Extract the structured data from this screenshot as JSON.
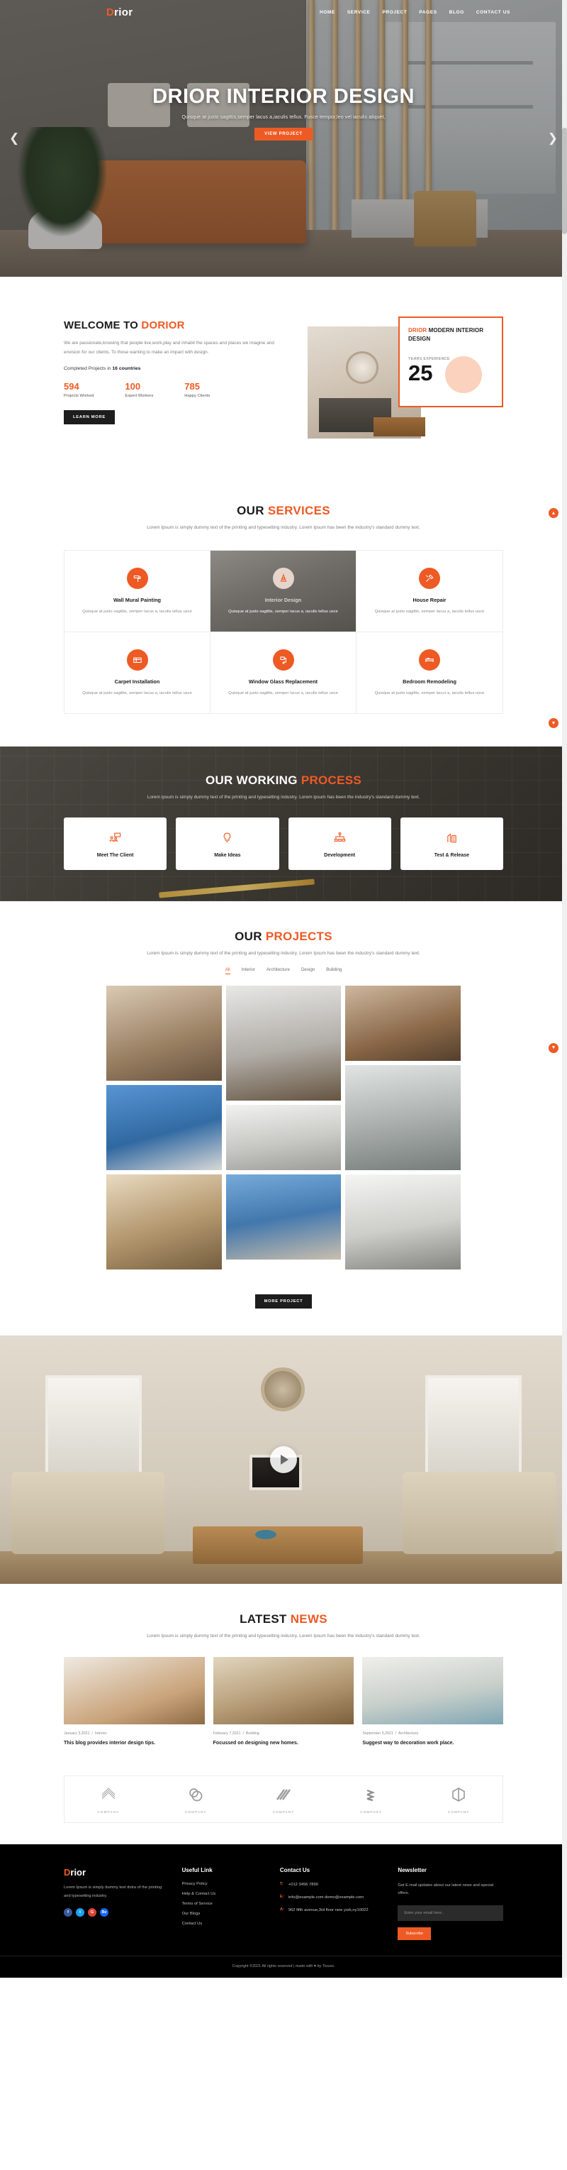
{
  "header": {
    "logo": "Drior",
    "logo_initial": "D",
    "logo_rest": "rior",
    "nav": [
      {
        "label": "HOME"
      },
      {
        "label": "SERVICE"
      },
      {
        "label": "PROJECT"
      },
      {
        "label": "PAGES"
      },
      {
        "label": "BLOG"
      },
      {
        "label": "CONTACT US"
      }
    ]
  },
  "hero": {
    "title": "DRIOR INTERIOR DESIGN",
    "subtitle": "Quisque at justo sagittis,semper lacus a,iaculis tellus. Fusce tempor,leo vel iaculis aliquet,",
    "cta": "VIEW PROJECT",
    "prev_icon": "chevron-left-icon",
    "next_icon": "chevron-right-icon"
  },
  "welcome": {
    "title_main": "WELCOME TO ",
    "title_accent": "DORIOR",
    "body": "We are passionate,knowing that people live,work,play and inhabit the spaces and places we imagine and envision for our clients. To those wanting to make an impact with design.",
    "completed_prefix": "Completed Projects in ",
    "completed_highlight": "16 countries",
    "stats": [
      {
        "number": "594",
        "label": "Projects Worked"
      },
      {
        "number": "100",
        "label": "Expert Workers"
      },
      {
        "number": "785",
        "label": "Happy Clients"
      }
    ],
    "cta": "LEARN MORE",
    "card": {
      "accent": "DRIOR",
      "rest": " MODERN INTERIOR DESIGN",
      "years_label": "YEARS EXPERIENCE",
      "years_value": "25"
    }
  },
  "services": {
    "title_main": "OUR ",
    "title_accent": "SERVICES",
    "subtitle": "Lorem Ipsum is simply dummy text of the printing and typesetting industry. Lorem Ipsum has been the industry's standard dummy text.",
    "items": [
      {
        "name": "Wall Mural Painting",
        "desc": "Quisque at justo sagittis, semper lacus a, iaculis tellus usce",
        "icon": "paint-roller-icon",
        "feature": false
      },
      {
        "name": "Interior Design",
        "desc": "Quisque at justo sagittis, semper lacus a, iaculis tellus usce",
        "icon": "compass-icon",
        "feature": true
      },
      {
        "name": "House Repair",
        "desc": "Quisque at justo sagittis, semper lacus a, iaculis tellus usce",
        "icon": "tools-icon",
        "feature": false
      },
      {
        "name": "Carpet Installation",
        "desc": "Quisque at justo sagittis, semper lacus a, iaculis tellus usce",
        "icon": "carpet-icon",
        "feature": false
      },
      {
        "name": "Window Glass Replacement",
        "desc": "Quisque at justo sagittis, semper lacus a, iaculis tellus usce",
        "icon": "window-spray-icon",
        "feature": false
      },
      {
        "name": "Bedroom Remodeling",
        "desc": "Quisque at justo sagittis, semper lacus a, iaculis tellus usce",
        "icon": "bed-icon",
        "feature": false
      }
    ]
  },
  "process": {
    "title_main": "OUR WORKING ",
    "title_accent": "PROCESS",
    "subtitle": "Lorem ipsum is simply dummy text of the printing and typesetting industry. Lorem ipsum has been the industry's standard dummy text.",
    "steps": [
      {
        "name": "Meet The Client",
        "icon": "meeting-icon"
      },
      {
        "name": "Make Ideas",
        "icon": "lightbulb-icon"
      },
      {
        "name": "Development",
        "icon": "sitemap-icon"
      },
      {
        "name": "Test & Release",
        "icon": "building-icon"
      }
    ]
  },
  "projects": {
    "title_main": "OUR ",
    "title_accent": "PROJECTS",
    "subtitle": "Lorem Ipsum is simply dummy text of the printing and typesetting industry. Lorem Ipsum has been the industry's standard dummy text.",
    "filters": [
      {
        "label": "All",
        "active": true
      },
      {
        "label": "Interior",
        "active": false
      },
      {
        "label": "Architecture",
        "active": false
      },
      {
        "label": "Design",
        "active": false
      },
      {
        "label": "Building",
        "active": false
      }
    ],
    "more_button": "MORE PROJECT"
  },
  "video": {
    "play_icon": "play-icon"
  },
  "news": {
    "title_main": "LATEST ",
    "title_accent": "NEWS",
    "subtitle": "Lorem Ipsum is simply dummy text of the printing and typesetting industry. Lorem Ipsum has been the industry's standard dummy text.",
    "posts": [
      {
        "date": "January 3,2021",
        "category": "Interior",
        "title": "This blog provides interior design tips."
      },
      {
        "date": "February 7,2021",
        "category": "Building",
        "title": "Focussed on designing new homes."
      },
      {
        "date": "September 5,2021",
        "category": "Architecture",
        "title": "Suggest way to decoration work place."
      }
    ]
  },
  "clients": [
    {
      "name": "COMPANY",
      "icon": "chevron-stack-logo"
    },
    {
      "name": "COMPANY",
      "icon": "interlocking-rings-logo"
    },
    {
      "name": "COMPANY",
      "icon": "slash-stripes-logo"
    },
    {
      "name": "COMPANY",
      "icon": "chevron-leaf-logo"
    },
    {
      "name": "COMPANY",
      "icon": "hexagon-logo"
    }
  ],
  "footer": {
    "logo_initial": "D",
    "logo_rest": "rior",
    "about": "Lorem Ipsum is simply dummy text dotra of the printing and typesetting industry.",
    "socials": [
      {
        "name": "facebook",
        "glyph": "f"
      },
      {
        "name": "twitter",
        "glyph": "t"
      },
      {
        "name": "google-plus",
        "glyph": "G"
      },
      {
        "name": "behance",
        "glyph": "Be"
      }
    ],
    "useful": {
      "heading": "Useful Link",
      "links": [
        {
          "label": "Privacy Policy"
        },
        {
          "label": "Help & Contact Us"
        },
        {
          "label": "Terms of Service"
        },
        {
          "label": "Our Blogs"
        },
        {
          "label": "Contact Us"
        }
      ]
    },
    "contact": {
      "heading": "Contact Us",
      "rows": [
        {
          "key": "T:",
          "value": "+012 3456 7890"
        },
        {
          "key": "E:",
          "value": "info@example.com demo@example.com"
        },
        {
          "key": "A:",
          "value": "962 fifth avenue,3rd floor new york,ny10022"
        }
      ]
    },
    "newsletter": {
      "heading": "Newsletter",
      "text": "Get E-mail updates about our latest news and special offers.",
      "placeholder": "Enter your email here..",
      "value": "",
      "button": "Subscribe"
    },
    "copyright": "Copyright ©2021 All rights reserved | made with ♥ by Ttuuss."
  },
  "colors": {
    "accent": "#ee5a24",
    "dark": "#1d1d1d",
    "muted": "#8a8a8a"
  }
}
